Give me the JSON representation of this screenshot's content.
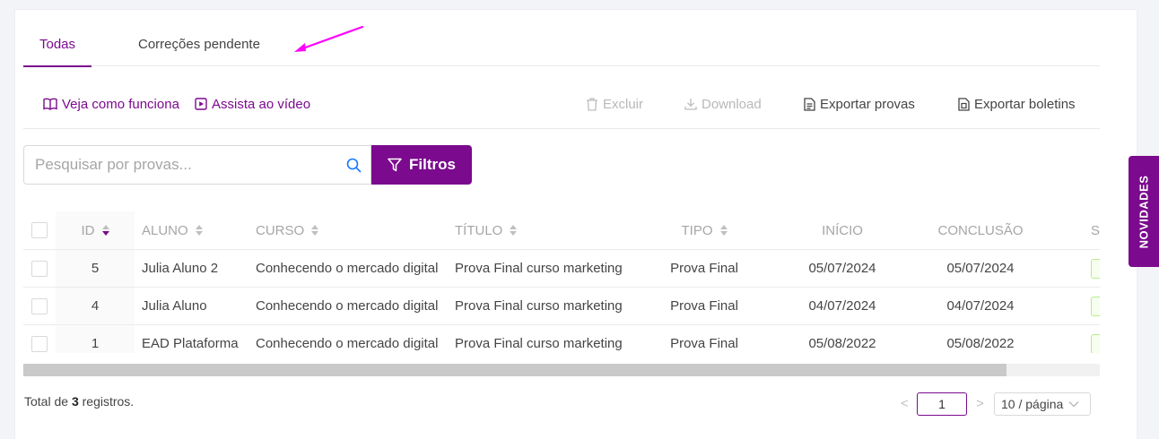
{
  "tabs": [
    {
      "label": "Todas",
      "active": true
    },
    {
      "label": "Correções pendente",
      "active": false
    }
  ],
  "toolbar": {
    "veja": "Veja como funciona",
    "assista": "Assista ao vídeo",
    "excluir": "Excluir",
    "download": "Download",
    "exportar_provas": "Exportar provas",
    "exportar_boletins": "Exportar boletins"
  },
  "search": {
    "placeholder": "Pesquisar por provas...",
    "value": ""
  },
  "filter_button": "Filtros",
  "table": {
    "headers": {
      "id": "ID",
      "aluno": "ALUNO",
      "curso": "CURSO",
      "titulo": "TÍTULO",
      "tipo": "TIPO",
      "inicio": "INÍCIO",
      "conclusao": "CONCLUSÃO",
      "status": "S"
    },
    "rows": [
      {
        "id": "5",
        "aluno": "Julia Aluno 2",
        "curso": "Conhecendo o mercado digital",
        "titulo": "Prova Final curso marketing",
        "tipo": "Prova Final",
        "inicio": "05/07/2024",
        "conclusao": "05/07/2024"
      },
      {
        "id": "4",
        "aluno": "Julia Aluno",
        "curso": "Conhecendo o mercado digital",
        "titulo": "Prova Final curso marketing",
        "tipo": "Prova Final",
        "inicio": "04/07/2024",
        "conclusao": "04/07/2024"
      },
      {
        "id": "1",
        "aluno": "EAD Plataforma",
        "curso": "Conhecendo o mercado digital",
        "titulo": "Prova Final curso marketing",
        "tipo": "Prova Final",
        "inicio": "05/08/2022",
        "conclusao": "05/08/2022"
      }
    ]
  },
  "footer": {
    "total_prefix": "Total de",
    "total_count": "3",
    "total_suffix": "registros."
  },
  "pagination": {
    "prev": "<",
    "current_page": "1",
    "next": ">",
    "page_size": "10 / página"
  },
  "side_tab": "NOVIDADES",
  "colors": {
    "accent": "#7b0a8e",
    "annotation_arrow": "#ff00ff"
  }
}
